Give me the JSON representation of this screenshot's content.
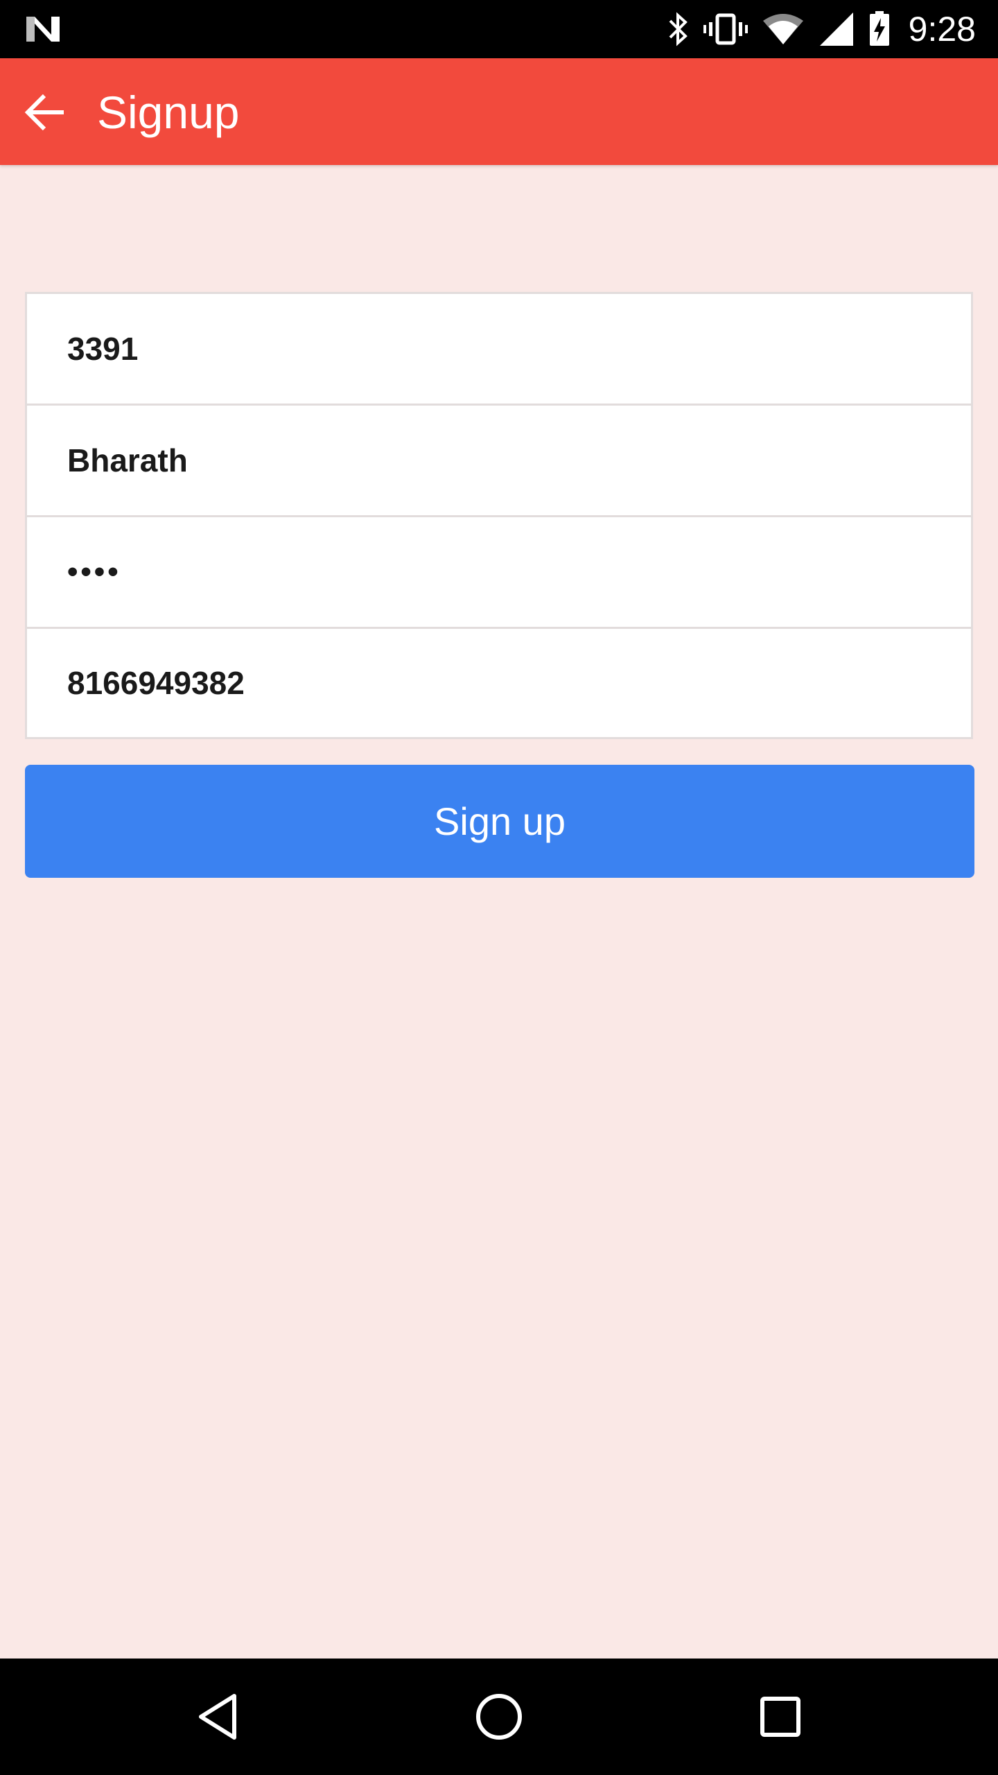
{
  "status_bar": {
    "time": "9:28",
    "icons": [
      "n-logo-icon",
      "bluetooth-icon",
      "vibrate-icon",
      "wifi-icon",
      "cell-signal-icon",
      "battery-charging-icon"
    ]
  },
  "app_bar": {
    "title": "Signup",
    "back_icon": "arrow-back-icon",
    "color": "#f24a3d"
  },
  "form": {
    "fields": [
      {
        "name": "id",
        "value": "3391"
      },
      {
        "name": "username",
        "value": "Bharath"
      },
      {
        "name": "password",
        "value": "••••"
      },
      {
        "name": "phone",
        "value": "8166949382"
      }
    ]
  },
  "signup_button": {
    "label": "Sign up",
    "color": "#3b82f1"
  },
  "nav_bar": {
    "icons": [
      "back-triangle-icon",
      "home-circle-icon",
      "recents-square-icon"
    ]
  },
  "background": "#fae8e6"
}
